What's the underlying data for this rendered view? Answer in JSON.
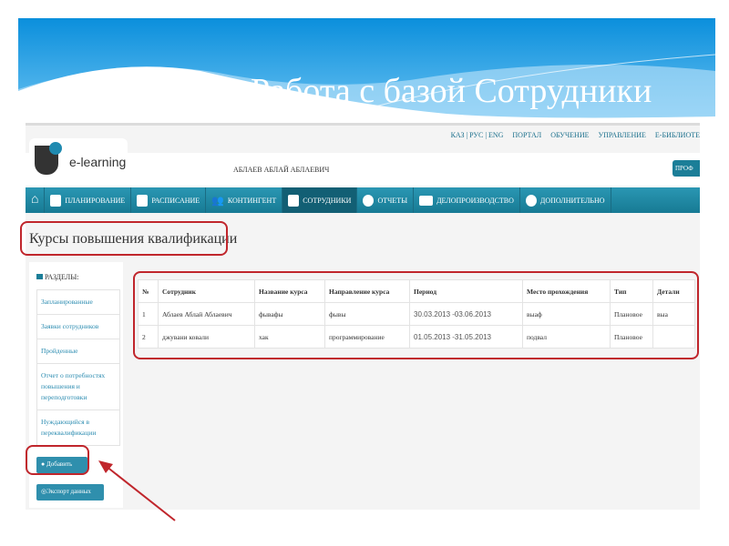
{
  "slide": {
    "title": "Работа с базой Сотрудники"
  },
  "app": {
    "logo_text": "e-learning",
    "top_links": [
      "КАЗ | РУС | ENG",
      "ПОРТАЛ",
      "ОБУЧЕНИЕ",
      "УПРАВЛЕНИЕ",
      "E-БИБЛИОТЕ"
    ],
    "user_name": "АБЛАЕВ АБЛАЙ АБЛАЕВИЧ",
    "profile_button": "ПРОФ",
    "nav": [
      {
        "label": "ПЛАНИРОВАНИЕ"
      },
      {
        "label": "РАСПИСАНИЕ"
      },
      {
        "label": "КОНТИНГЕНТ"
      },
      {
        "label": "СОТРУДНИКИ"
      },
      {
        "label": "ОТЧЕТЫ"
      },
      {
        "label": "ДЕЛОПРОИЗВОДСТВО"
      },
      {
        "label": "ДОПОЛНИТЕЛЬНО"
      }
    ],
    "page_title": "Курсы повышения квалификации",
    "sidebar": {
      "label": "РАЗДЕЛЫ:",
      "items": [
        "Запланированные",
        "Заявки сотрудников",
        "Пройденные",
        "Отчет о потребностях повышения и переподготовки",
        "Нуждающийся в переквалификации"
      ],
      "add_button": "Добавить",
      "export_button": "Экспорт данных"
    },
    "table": {
      "headers": [
        "№",
        "Сотрудник",
        "Название курса",
        "Направление курса",
        "Период",
        "Место прохождения",
        "Тип",
        "Детали"
      ],
      "rows": [
        [
          "1",
          "Аблаев Аблай Аблаевич",
          "фывафы",
          "фывы",
          "30.03.2013 -03.06.2013",
          "выаф",
          "Плановое",
          "выа"
        ],
        [
          "2",
          "джувани ковали",
          "хак",
          "программирование",
          "01.05.2013 -31.05.2013",
          "подвал",
          "Плановое",
          ""
        ]
      ]
    }
  },
  "colors": {
    "nav": "#1b7e98",
    "accent_red": "#c0262c",
    "banner": "#0b8fdc"
  }
}
